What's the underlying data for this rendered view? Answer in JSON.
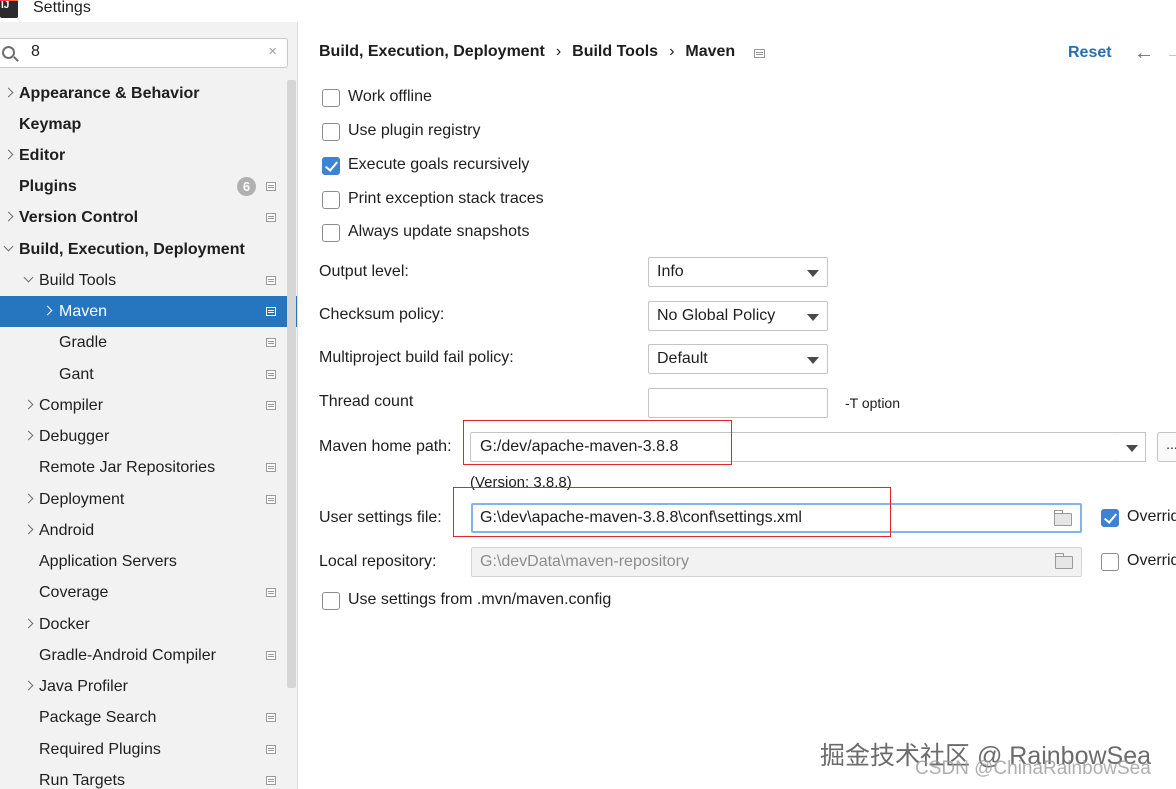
{
  "window": {
    "title": "Settings"
  },
  "search": {
    "value": "8",
    "clear_glyph": "×"
  },
  "sidebar": {
    "items": [
      {
        "label": "Appearance & Behavior"
      },
      {
        "label": "Keymap"
      },
      {
        "label": "Editor"
      },
      {
        "label": "Plugins",
        "badge": "6"
      },
      {
        "label": "Version Control"
      },
      {
        "label": "Build, Execution, Deployment"
      },
      {
        "label": "Build Tools"
      },
      {
        "label": "Maven"
      },
      {
        "label": "Gradle"
      },
      {
        "label": "Gant"
      },
      {
        "label": "Compiler"
      },
      {
        "label": "Debugger"
      },
      {
        "label": "Remote Jar Repositories"
      },
      {
        "label": "Deployment"
      },
      {
        "label": "Android"
      },
      {
        "label": "Application Servers"
      },
      {
        "label": "Coverage"
      },
      {
        "label": "Docker"
      },
      {
        "label": "Gradle-Android Compiler"
      },
      {
        "label": "Java Profiler"
      },
      {
        "label": "Package Search"
      },
      {
        "label": "Required Plugins"
      },
      {
        "label": "Run Targets"
      }
    ]
  },
  "header": {
    "breadcrumb": [
      "Build, Execution, Deployment",
      "Build Tools",
      "Maven"
    ],
    "separator": "›",
    "reset_label": "Reset",
    "back_glyph": "←",
    "forward_glyph": "→"
  },
  "options": [
    {
      "label": "Work offline",
      "checked": false
    },
    {
      "label": "Use plugin registry",
      "checked": false
    },
    {
      "label": "Execute goals recursively",
      "checked": true
    },
    {
      "label": "Print exception stack traces",
      "checked": false
    },
    {
      "label": "Always update snapshots",
      "checked": false
    }
  ],
  "form": {
    "output_level": {
      "label": "Output level:",
      "value": "Info"
    },
    "checksum_policy": {
      "label": "Checksum policy:",
      "value": "No Global Policy"
    },
    "fail_policy": {
      "label": "Multiproject build fail policy:",
      "value": "Default"
    },
    "thread_count": {
      "label": "Thread count",
      "value": "",
      "hint": "-T option"
    },
    "maven_home": {
      "label": "Maven home path:",
      "value": "G:/dev/apache-maven-3.8.8",
      "browse": "...",
      "version": "(Version: 3.8.8)"
    },
    "user_settings": {
      "label": "User settings file:",
      "value": "G:\\dev\\apache-maven-3.8.8\\conf\\settings.xml",
      "override_label": "Override",
      "override_checked": true
    },
    "local_repo": {
      "label": "Local repository:",
      "value": "G:\\devData\\maven-repository",
      "override_label": "Override",
      "override_checked": false
    },
    "mvn_config": {
      "label": "Use settings from .mvn/maven.config",
      "checked": false
    }
  },
  "watermark": {
    "line1": "掘金技术社区 @ RainbowSea",
    "line2": "CSDN @ChinaRainbowSea"
  },
  "colors": {
    "selection": "#2675bf",
    "link": "#2470b3",
    "highlight_box": "#e0262b",
    "checkbox_checked": "#3c83d3"
  }
}
